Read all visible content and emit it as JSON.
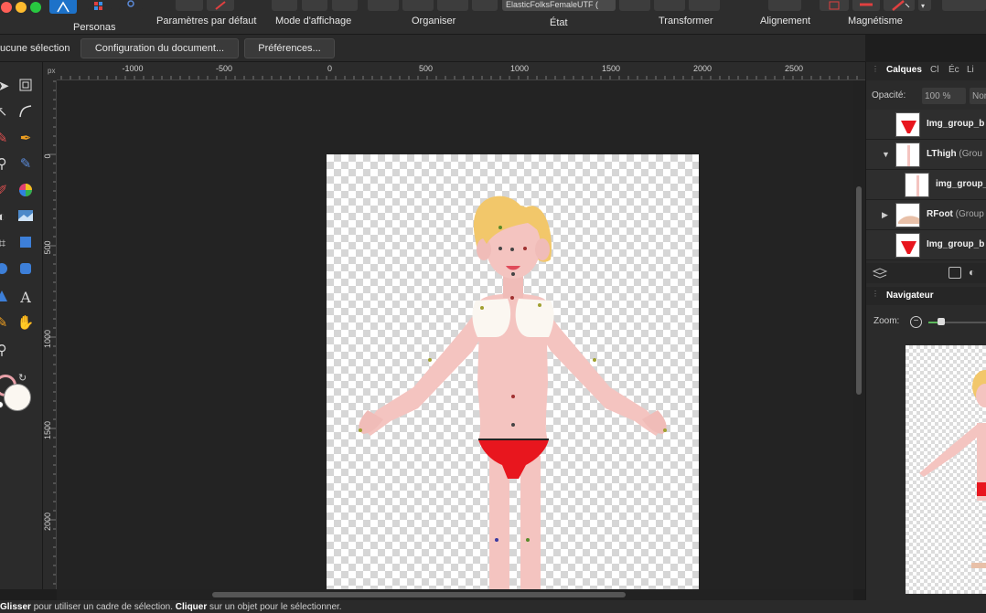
{
  "toolbar": {
    "personas_label": "Personas",
    "defaults_label": "Paramètres par défaut",
    "view_mode_label": "Mode d'affichage",
    "arrange_label": "Organiser",
    "document_name": "ElasticFolksFemaleUTF (",
    "state_label": "État",
    "transform_label": "Transformer",
    "align_label": "Alignement",
    "snapping_label": "Magnétisme"
  },
  "context": {
    "selection_label": "ucune sélection",
    "doc_setup_label": "Configuration du document...",
    "preferences_label": "Préférences..."
  },
  "ruler": {
    "unit": "px",
    "top_labels": [
      "-1000",
      "-500",
      "0",
      "500",
      "1000",
      "1500",
      "2000",
      "2500"
    ],
    "left_labels": [
      "0",
      "500",
      "1000",
      "1500",
      "2000"
    ]
  },
  "panel": {
    "tabs": [
      "Calques",
      "Cl",
      "Éc",
      "Li"
    ],
    "opacity_label": "Opacité:",
    "opacity_value": "100 %",
    "blend_value": "Nor",
    "layers": [
      {
        "name": "Img_group_b",
        "group": ""
      },
      {
        "name": "LThigh",
        "group": "(Grou"
      },
      {
        "name": "img_group_",
        "group": ""
      },
      {
        "name": "RFoot",
        "group": "(Group"
      },
      {
        "name": "Img_group_b",
        "group": ""
      }
    ],
    "navigator_label": "Navigateur",
    "zoom_label": "Zoom:"
  },
  "status": {
    "drag_word": "Glisser",
    "drag_text": " pour utiliser un cadre de sélection. ",
    "click_word": "Cliquer",
    "click_text": " sur un objet pour le sélectionner."
  },
  "colors": {
    "skin": "#f4c4c0",
    "hair": "#f2c76a",
    "bikini": "#e8161e",
    "top": "#fbf7f1",
    "accent": "#1d72c9"
  }
}
